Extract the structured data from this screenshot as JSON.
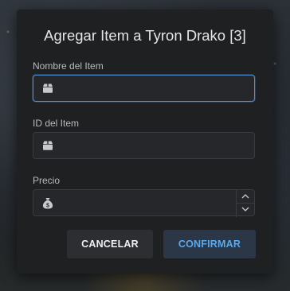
{
  "dialog": {
    "title": "Agregar Item a Tyron Drako [3]",
    "fields": [
      {
        "label": "Nombre del Item",
        "value": "",
        "icon": "box-icon"
      },
      {
        "label": "ID del Item",
        "value": "",
        "icon": "box-icon"
      },
      {
        "label": "Precio",
        "value": "",
        "icon": "money-bag-icon"
      }
    ],
    "buttons": {
      "cancel": "CANCELAR",
      "confirm": "CONFIRMAR"
    }
  },
  "colors": {
    "dialog_bg": "#1f2022",
    "focus_border": "#4f8fd6",
    "confirm_text": "#5aa9ec",
    "confirm_bg": "#2b3746"
  }
}
